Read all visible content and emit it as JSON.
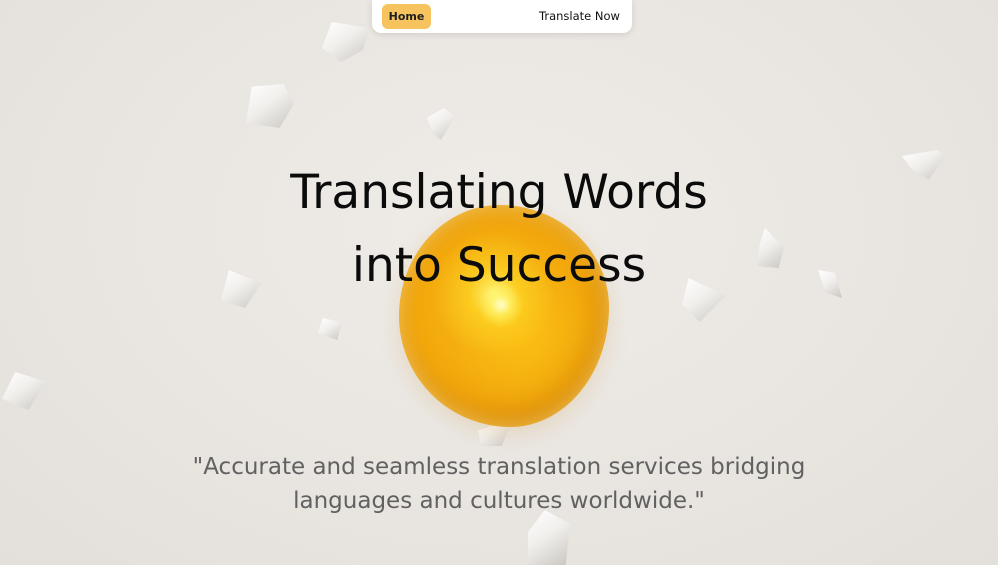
{
  "nav": {
    "home_label": "Home",
    "translate_label": "Translate Now"
  },
  "hero": {
    "title_line1": "Translating Words",
    "title_line2": "into Success",
    "tagline_line1": "\"Accurate and seamless translation services bridging",
    "tagline_line2": "languages and cultures worldwide.\""
  },
  "colors": {
    "accent": "#f6c35f",
    "orb": "#f3a90c",
    "background": "#ebe7e2",
    "title_text": "#0b0b0b",
    "tagline_text": "#616161"
  }
}
